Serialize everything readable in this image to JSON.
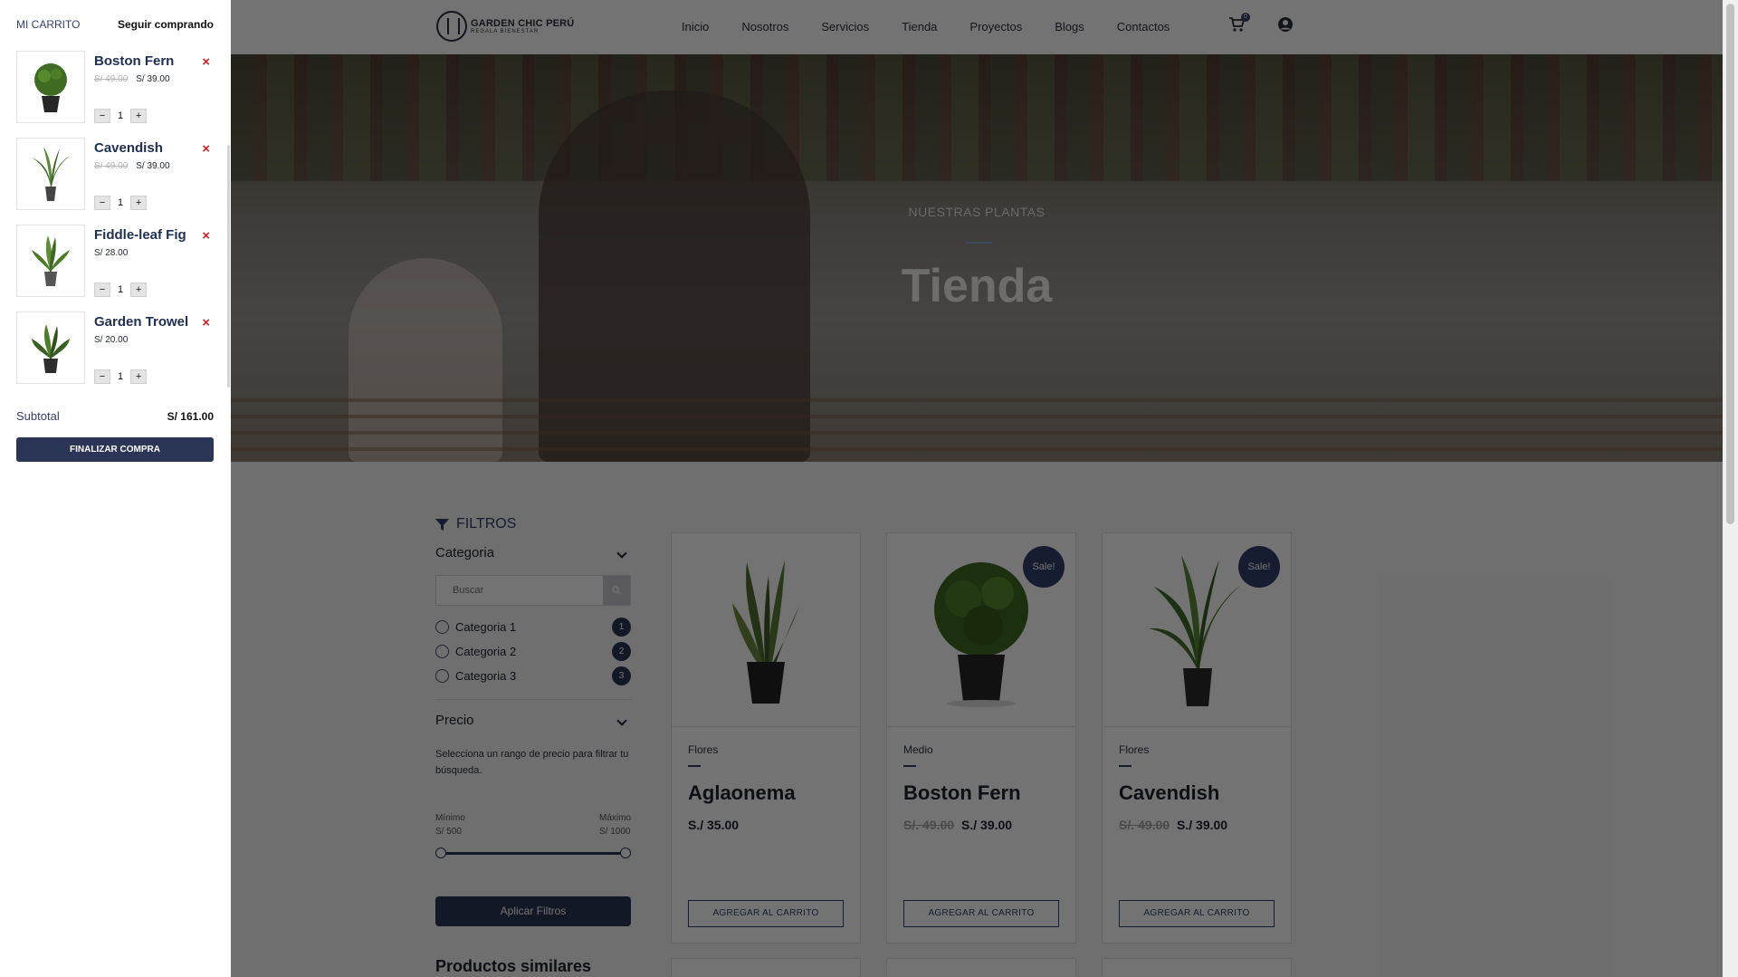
{
  "cart": {
    "title": "MI CARRITO",
    "continue_label": "Seguir comprando",
    "items": [
      {
        "name": "Boston Fern",
        "old_price": "S/ 49.00",
        "price": "S/ 39.00",
        "qty": "1",
        "icon": "round-bush-plant-icon"
      },
      {
        "name": "Cavendish",
        "old_price": "S/ 49.00",
        "price": "S/ 39.00",
        "qty": "1",
        "icon": "palm-plant-icon"
      },
      {
        "name": "Fiddle-leaf Fig",
        "old_price": "",
        "price": "S/ 28.00",
        "qty": "1",
        "icon": "fern-plant-icon"
      },
      {
        "name": "Garden Trowel",
        "old_price": "",
        "price": "S/ 20.00",
        "qty": "1",
        "icon": "leafy-plant-icon"
      }
    ],
    "minus": "−",
    "plus": "+",
    "remove": "×",
    "subtotal_label": "Subtotal",
    "subtotal_value": "S/ 161.00",
    "checkout_label": "FINALIZAR COMPRA"
  },
  "nav": {
    "logo_title": "GARDEN CHIC PERÚ",
    "logo_subtitle": "REGALA BIENESTAR",
    "links": [
      "Inicio",
      "Nosotros",
      "Servicios",
      "Tienda",
      "Proyectos",
      "Blogs",
      "Contactos"
    ],
    "cart_count": "0"
  },
  "hero": {
    "subtitle": "NUESTRAS PLANTAS",
    "title": "Tienda"
  },
  "filters": {
    "title": "FILTROS",
    "category_title": "Categoria",
    "search_placeholder": "Buscar",
    "categories": [
      {
        "label": "Categoria 1",
        "count": "1"
      },
      {
        "label": "Categoria 2",
        "count": "2"
      },
      {
        "label": "Categoria 3",
        "count": "3"
      }
    ],
    "price_title": "Precio",
    "price_desc": "Selecciona un rango de precio para filtrar tu búsqueda.",
    "min_label": "Mínimo",
    "min_value": "S/ 500",
    "max_label": "Máximo",
    "max_value": "S/ 1000",
    "apply_label": "Aplicar Filtros",
    "similar_title": "Productos similares"
  },
  "products": [
    {
      "category": "Flores",
      "name": "Aglaonema",
      "old_price": "",
      "price": "S./ 35.00",
      "sale": "",
      "button": "AGREGAR AL CARRITO",
      "icon": "snake-plant-icon"
    },
    {
      "category": "Medio",
      "name": "Boston Fern",
      "old_price": "S/. 49.00",
      "price": "S./ 39.00",
      "sale": "Sale!",
      "button": "AGREGAR AL CARRITO",
      "icon": "round-bush-plant-icon"
    },
    {
      "category": "Flores",
      "name": "Cavendish",
      "old_price": "S/. 49.00",
      "price": "S./ 39.00",
      "sale": "Sale!",
      "button": "AGREGAR AL CARRITO",
      "icon": "palm-plant-icon"
    }
  ],
  "colors": {
    "primary": "#2b3555",
    "accent": "#34406b",
    "remove": "#d42020"
  }
}
